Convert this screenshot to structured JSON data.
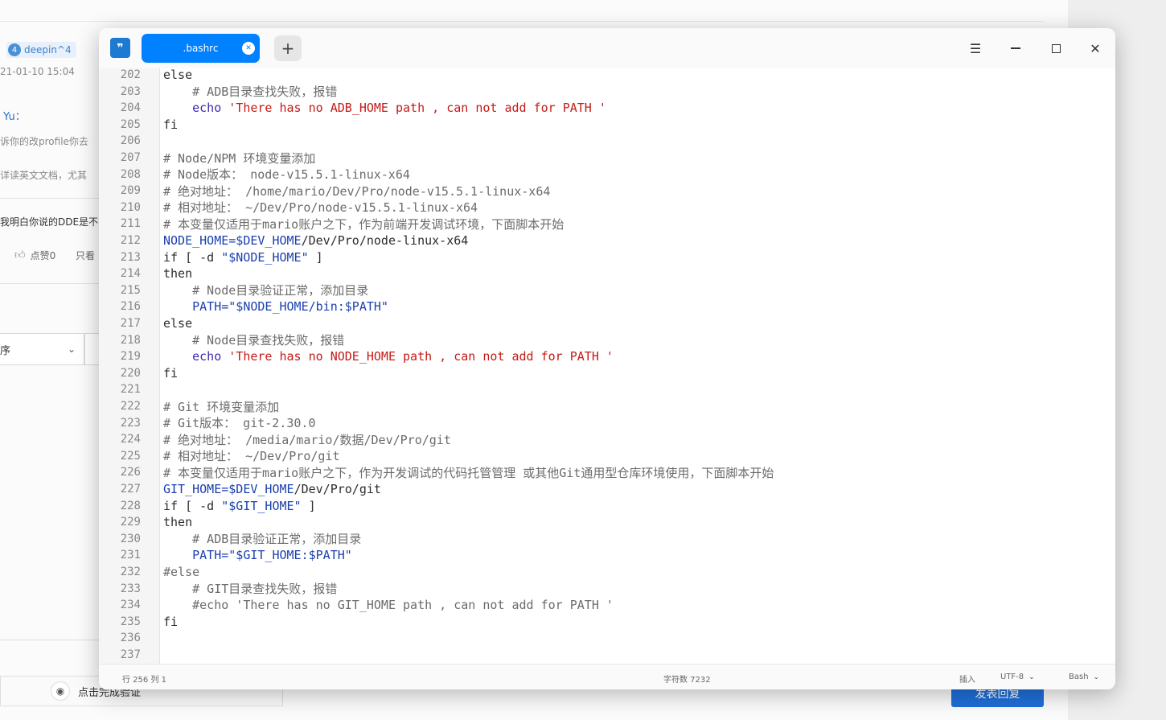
{
  "background": {
    "username": "deepin^4",
    "level": "4",
    "date": "21-01-10 15:04",
    "reply_user": "Yu：",
    "line1": "诉你的改profile你去",
    "line2": "详读英文文档，尤其",
    "line3": "我明白你说的DDE是不",
    "like_label": "点赞0",
    "only_label": "只看",
    "select_value": "序",
    "captcha_label": "点击完成验证",
    "submit_label": "发表回复"
  },
  "editor": {
    "tab_title": ".bashrc",
    "new_tab_label": "+",
    "lines": [
      {
        "n": "202",
        "parts": [
          {
            "t": "else",
            "c": "kw"
          }
        ]
      },
      {
        "n": "203",
        "parts": [
          {
            "t": "    # ADB目录查找失败，报错",
            "c": "comment"
          }
        ]
      },
      {
        "n": "204",
        "parts": [
          {
            "t": "    echo ",
            "c": "cmd"
          },
          {
            "t": "'There has no ADB_HOME path , can not add for PATH '",
            "c": "str"
          }
        ]
      },
      {
        "n": "205",
        "parts": [
          {
            "t": "fi",
            "c": "kw"
          }
        ]
      },
      {
        "n": "206",
        "parts": [
          {
            "t": "",
            "c": "kw"
          }
        ]
      },
      {
        "n": "207",
        "parts": [
          {
            "t": "# Node/NPM 环境变量添加",
            "c": "comment"
          }
        ]
      },
      {
        "n": "208",
        "parts": [
          {
            "t": "# Node版本： node-v15.5.1-linux-x64",
            "c": "comment"
          }
        ]
      },
      {
        "n": "209",
        "parts": [
          {
            "t": "# 绝对地址： /home/mario/Dev/Pro/node-v15.5.1-linux-x64",
            "c": "comment"
          }
        ]
      },
      {
        "n": "210",
        "parts": [
          {
            "t": "# 相对地址： ~/Dev/Pro/node-v15.5.1-linux-x64",
            "c": "comment"
          }
        ]
      },
      {
        "n": "211",
        "parts": [
          {
            "t": "# 本变量仅适用于mario账户之下，作为前端开发调试环境，下面脚本开始",
            "c": "comment"
          }
        ]
      },
      {
        "n": "212",
        "parts": [
          {
            "t": "NODE_HOME=$DEV_HOME",
            "c": "var"
          },
          {
            "t": "/Dev/Pro/node-linux-x64",
            "c": "kw"
          }
        ]
      },
      {
        "n": "213",
        "parts": [
          {
            "t": "if [ -d ",
            "c": "kw"
          },
          {
            "t": "\"$NODE_HOME\"",
            "c": "var"
          },
          {
            "t": " ]",
            "c": "kw"
          }
        ]
      },
      {
        "n": "214",
        "parts": [
          {
            "t": "then",
            "c": "kw"
          }
        ]
      },
      {
        "n": "215",
        "parts": [
          {
            "t": "    # Node目录验证正常，添加目录",
            "c": "comment"
          }
        ]
      },
      {
        "n": "216",
        "parts": [
          {
            "t": "    PATH=\"$NODE_HOME/bin:$PATH\"",
            "c": "var"
          }
        ]
      },
      {
        "n": "217",
        "parts": [
          {
            "t": "else",
            "c": "kw"
          }
        ]
      },
      {
        "n": "218",
        "parts": [
          {
            "t": "    # Node目录查找失败，报错",
            "c": "comment"
          }
        ]
      },
      {
        "n": "219",
        "parts": [
          {
            "t": "    echo ",
            "c": "cmd"
          },
          {
            "t": "'There has no NODE_HOME path , can not add for PATH '",
            "c": "str"
          }
        ]
      },
      {
        "n": "220",
        "parts": [
          {
            "t": "fi",
            "c": "kw"
          }
        ]
      },
      {
        "n": "221",
        "parts": [
          {
            "t": "",
            "c": "kw"
          }
        ]
      },
      {
        "n": "222",
        "parts": [
          {
            "t": "# Git 环境变量添加",
            "c": "comment"
          }
        ]
      },
      {
        "n": "223",
        "parts": [
          {
            "t": "# Git版本： git-2.30.0",
            "c": "comment"
          }
        ]
      },
      {
        "n": "224",
        "parts": [
          {
            "t": "# 绝对地址： /media/mario/数据/Dev/Pro/git",
            "c": "comment"
          }
        ]
      },
      {
        "n": "225",
        "parts": [
          {
            "t": "# 相对地址： ~/Dev/Pro/git",
            "c": "comment"
          }
        ]
      },
      {
        "n": "226",
        "parts": [
          {
            "t": "# 本变量仅适用于mario账户之下，作为开发调试的代码托管管理 或其他Git通用型仓库环境使用，下面脚本开始",
            "c": "comment"
          }
        ]
      },
      {
        "n": "227",
        "parts": [
          {
            "t": "GIT_HOME=$DEV_HOME",
            "c": "var"
          },
          {
            "t": "/Dev/Pro/git",
            "c": "kw"
          }
        ]
      },
      {
        "n": "228",
        "parts": [
          {
            "t": "if [ -d ",
            "c": "kw"
          },
          {
            "t": "\"$GIT_HOME\"",
            "c": "var"
          },
          {
            "t": " ]",
            "c": "kw"
          }
        ]
      },
      {
        "n": "229",
        "parts": [
          {
            "t": "then",
            "c": "kw"
          }
        ]
      },
      {
        "n": "230",
        "parts": [
          {
            "t": "    # ADB目录验证正常，添加目录",
            "c": "comment"
          }
        ]
      },
      {
        "n": "231",
        "parts": [
          {
            "t": "    PATH=\"$GIT_HOME:$PATH\"",
            "c": "var"
          }
        ]
      },
      {
        "n": "232",
        "parts": [
          {
            "t": "#else",
            "c": "comment"
          }
        ]
      },
      {
        "n": "233",
        "parts": [
          {
            "t": "    # GIT目录查找失败，报错",
            "c": "comment"
          }
        ]
      },
      {
        "n": "234",
        "parts": [
          {
            "t": "    #echo 'There has no GIT_HOME path , can not add for PATH '",
            "c": "comment"
          }
        ]
      },
      {
        "n": "235",
        "parts": [
          {
            "t": "fi",
            "c": "kw"
          }
        ]
      },
      {
        "n": "236",
        "parts": [
          {
            "t": "",
            "c": "kw"
          }
        ]
      },
      {
        "n": "237",
        "parts": [
          {
            "t": "",
            "c": "kw"
          }
        ]
      }
    ]
  },
  "status": {
    "position": "行 256  列 1",
    "char_count": "字符数 7232",
    "mode": "插入",
    "encoding": "UTF-8",
    "language": "Bash"
  },
  "colors": {
    "tab_active": "#0081ff",
    "string": "#c41a16",
    "variable": "#1a3fae",
    "comment": "#6b6b6b",
    "submit": "#1f6fd8"
  }
}
